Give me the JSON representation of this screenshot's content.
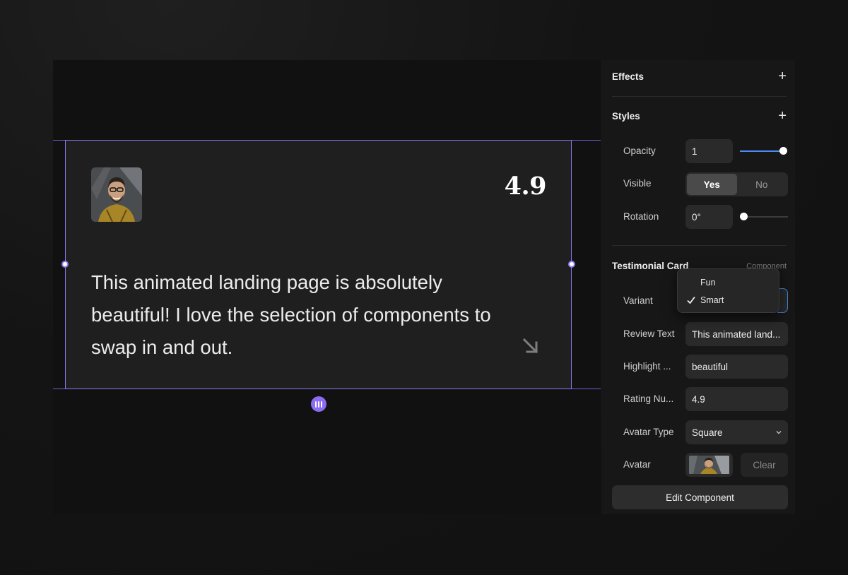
{
  "card": {
    "rating": "4.9",
    "review_text": "This animated landing page is absolutely beautiful! I love the selection of components to swap in and out."
  },
  "panel": {
    "effects": {
      "title": "Effects",
      "add_label": "+"
    },
    "styles": {
      "title": "Styles",
      "add_label": "+",
      "opacity": {
        "label": "Opacity",
        "value": "1",
        "slider_level": 1.0
      },
      "visible": {
        "label": "Visible",
        "options": [
          "Yes",
          "No"
        ],
        "selected": "Yes"
      },
      "rotation": {
        "label": "Rotation",
        "value": "0°",
        "slider_level": 0.0
      }
    },
    "component": {
      "title": "Testimonial Card",
      "tag": "Component",
      "variant": {
        "label": "Variant",
        "options": [
          "Fun",
          "Smart"
        ],
        "selected": "Smart"
      },
      "review_text": {
        "label": "Review Text",
        "value": "This animated land..."
      },
      "highlight": {
        "label": "Highlight ...",
        "value": "beautiful"
      },
      "rating_number": {
        "label": "Rating Nu...",
        "value": "4.9"
      },
      "avatar_type": {
        "label": "Avatar Type",
        "value": "Square"
      },
      "avatar": {
        "label": "Avatar",
        "clear_label": "Clear"
      },
      "edit_button": "Edit Component"
    }
  },
  "colors": {
    "accent_purple": "#8b7af0",
    "slider_blue": "#4a8cf0",
    "panel_bg": "#171717",
    "card_bg": "#1f1f1f"
  }
}
